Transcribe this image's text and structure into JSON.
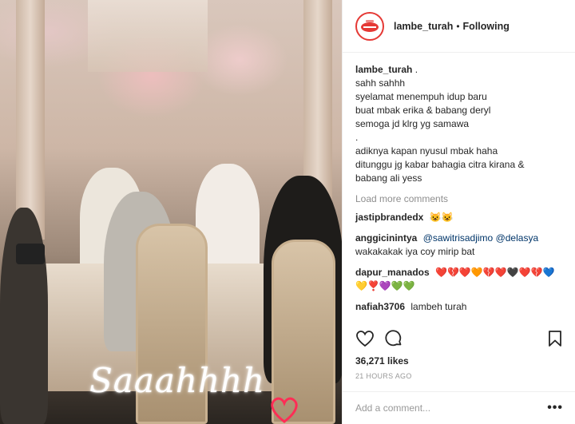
{
  "media": {
    "overlay_text": "Saaahhhh"
  },
  "header": {
    "username": "lambe_turah",
    "separator": "•",
    "follow_state": "Following"
  },
  "caption": {
    "username": "lambe_turah",
    "period": ".",
    "lines": [
      "sahh sahhh",
      "syelamat menempuh idup baru",
      "buat mbak erika & babang deryl",
      "semoga jd klrg yg samawa",
      ".",
      "adiknya kapan nyusul mbak haha",
      "ditunggu jg kabar bahagia citra kirana &",
      "babang ali yess"
    ]
  },
  "load_more": "Load more comments",
  "comments": [
    {
      "username": "jastipbrandedx",
      "text": "😺😺"
    },
    {
      "username": "anggicinintya",
      "mention1": "@sawitrisadjimo",
      "mention2": "@delasya",
      "text": "wakakakak iya coy mirip bat"
    },
    {
      "username": "dapur_manados",
      "text": "❤️💔❤️🧡💔❤️🖤❤️💔💙💛❣️💜💚💚"
    },
    {
      "username": "nafiah3706",
      "text": "lambeh turah"
    }
  ],
  "likes": "36,271 likes",
  "timestamp": "21 HOURS AGO",
  "add_comment_placeholder": "Add a comment...",
  "more_label": "•••",
  "colors": {
    "brand_red": "#e53935",
    "link_blue": "#003569",
    "muted": "#8e8e8e"
  },
  "icons": [
    "heart-icon",
    "comment-icon",
    "bookmark-icon",
    "lips-logo-icon",
    "heart-sticker-icon"
  ]
}
